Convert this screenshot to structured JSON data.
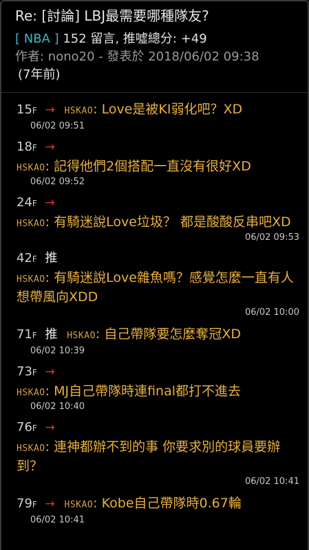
{
  "post": {
    "title": "Re: [討論] LBJ最需要哪種隊友?",
    "board": "[ NBA ]",
    "count_text": "152 留言, 推噓總分: +49",
    "author_line": "作者: nono20 - 發表於 2018/06/02 09:38",
    "ago": "(7年前)"
  },
  "comments": [
    {
      "floor": "15",
      "f": "F",
      "tag": "→",
      "user": "HSKAO",
      "text": "Love是被KI弱化吧？XD",
      "time": "06/02 09:51"
    },
    {
      "floor": "18",
      "f": "F",
      "tag": "→",
      "user": "HSKAO",
      "text": "記得他們2個搭配一直沒有很好XD",
      "time": "06/02 09:52"
    },
    {
      "floor": "24",
      "f": "F",
      "tag": "→",
      "user": "HSKAO",
      "text": "有騎迷說Love垃圾？ 都是酸酸反串吧XD",
      "time": "06/02 09:53"
    },
    {
      "floor": "42",
      "f": "F",
      "tag": "推",
      "user": "HSKAO",
      "text": "有騎迷說Love雜魚嗎？感覺怎麼一直有人想帶風向XDD",
      "time": "06/02 10:00"
    },
    {
      "floor": "71",
      "f": "F",
      "tag": "推",
      "user": "HSKAO",
      "text": "自己帶隊要怎麼奪冠XD",
      "time": "06/02 10:39"
    },
    {
      "floor": "73",
      "f": "F",
      "tag": "→",
      "user": "HSKAO",
      "text": "MJ自己帶隊時連final都打不進去",
      "time": "06/02 10:40"
    },
    {
      "floor": "76",
      "f": "F",
      "tag": "→",
      "user": "HSKAO",
      "text": "連神都辦不到的事 你要求別的球員要辦到？",
      "time": "06/02 10:41"
    },
    {
      "floor": "79",
      "f": "F",
      "tag": "→",
      "user": "HSKAO",
      "text": "Kobe自己帶隊時0.67輪",
      "time": "06/02 10:41"
    }
  ],
  "colors": {
    "background": "#000000",
    "board": "#3fb8c8",
    "arrow": "#e0342f",
    "comment_text": "#e8b040",
    "user": "#d6a24a"
  }
}
